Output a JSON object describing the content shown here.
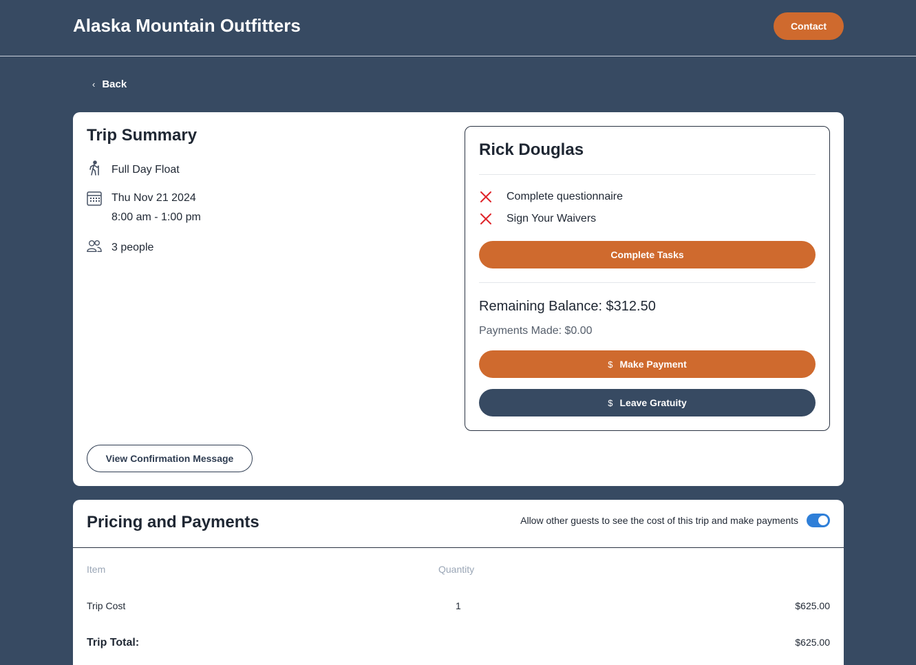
{
  "header": {
    "brand": "Alaska Mountain Outfitters",
    "contact_label": "Contact"
  },
  "nav": {
    "back_label": "Back"
  },
  "trip_summary": {
    "title": "Trip Summary",
    "activity": "Full Day Float",
    "date": "Thu Nov 21 2024",
    "time": "8:00 am - 1:00 pm",
    "party": "3 people",
    "view_confirmation_label": "View Confirmation Message"
  },
  "guest": {
    "name": "Rick Douglas",
    "tasks": [
      {
        "label": "Complete questionnaire",
        "done": false
      },
      {
        "label": "Sign Your Waivers",
        "done": false
      }
    ],
    "complete_tasks_label": "Complete Tasks",
    "remaining_balance": "Remaining Balance: $312.50",
    "payments_made": "Payments Made: $0.00",
    "make_payment_label": "Make Payment",
    "leave_gratuity_label": "Leave Gratuity",
    "currency_symbol": "$"
  },
  "pricing": {
    "title": "Pricing and Payments",
    "toggle_label": "Allow other guests to see the cost of this trip and make payments",
    "toggle_on": true,
    "columns": {
      "item": "Item",
      "quantity": "Quantity"
    },
    "rows": [
      {
        "item": "Trip Cost",
        "quantity": "1",
        "amount": "$625.00"
      }
    ],
    "total_label": "Trip Total:",
    "total_amount": "$625.00"
  },
  "colors": {
    "background": "#374a62",
    "accent_orange": "#cf6a2e",
    "toggle_blue": "#2f7fd8",
    "error_red": "#e0262b"
  }
}
